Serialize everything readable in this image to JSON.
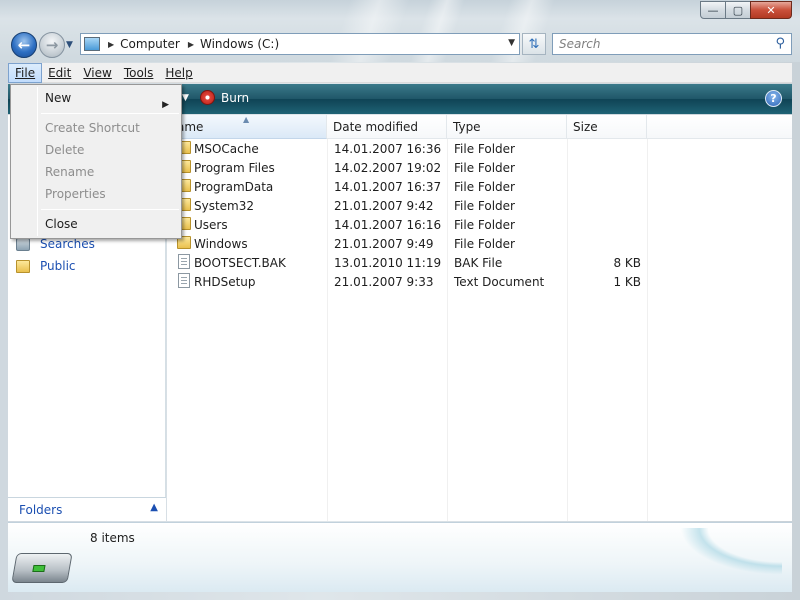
{
  "window": {
    "caption_buttons": {
      "minimize": "—",
      "maximize": "▢",
      "close": "✕"
    }
  },
  "navigation": {
    "back_icon": "arrow-left-icon",
    "forward_icon": "arrow-right-icon",
    "address_segments": [
      "Computer",
      "Windows (C:)"
    ],
    "search_placeholder": "Search"
  },
  "menu_bar": {
    "items": [
      "File",
      "Edit",
      "View",
      "Tools",
      "Help"
    ],
    "active": "File"
  },
  "command_bar": {
    "burn_label": "Burn"
  },
  "file_menu": {
    "items": [
      {
        "label": "New",
        "enabled": true,
        "submenu": true
      },
      {
        "label": "Create Shortcut",
        "enabled": false
      },
      {
        "label": "Delete",
        "enabled": false
      },
      {
        "label": "Rename",
        "enabled": false
      },
      {
        "label": "Properties",
        "enabled": false
      },
      {
        "label": "Close",
        "enabled": true
      }
    ]
  },
  "nav_pane": {
    "links": [
      {
        "label": "Searches",
        "icon": "saved-search-icon"
      },
      {
        "label": "Public",
        "icon": "folder-icon"
      }
    ],
    "folders_label": "Folders"
  },
  "file_list": {
    "columns": [
      "Name",
      "Date modified",
      "Type",
      "Size"
    ],
    "header_visible_name": "ame",
    "rows": [
      {
        "name": "MSOCache",
        "date": "14.01.2007 16:36",
        "type": "File Folder",
        "size": "",
        "kind": "folder"
      },
      {
        "name": "Program Files",
        "date": "14.02.2007 19:02",
        "type": "File Folder",
        "size": "",
        "kind": "folder"
      },
      {
        "name": "ProgramData",
        "date": "14.01.2007 16:37",
        "type": "File Folder",
        "size": "",
        "kind": "folder"
      },
      {
        "name": "System32",
        "date": "21.01.2007 9:42",
        "type": "File Folder",
        "size": "",
        "kind": "folder"
      },
      {
        "name": "Users",
        "date": "14.01.2007 16:16",
        "type": "File Folder",
        "size": "",
        "kind": "folder"
      },
      {
        "name": "Windows",
        "date": "21.01.2007 9:49",
        "type": "File Folder",
        "size": "",
        "kind": "folder"
      },
      {
        "name": "BOOTSECT.BAK",
        "date": "13.01.2010 11:19",
        "type": "BAK File",
        "size": "8 KB",
        "kind": "file"
      },
      {
        "name": "RHDSetup",
        "date": "21.01.2007 9:33",
        "type": "Text Document",
        "size": "1 KB",
        "kind": "file"
      }
    ]
  },
  "details_pane": {
    "item_count": "8 items",
    "icon": "hard-drive-icon"
  }
}
